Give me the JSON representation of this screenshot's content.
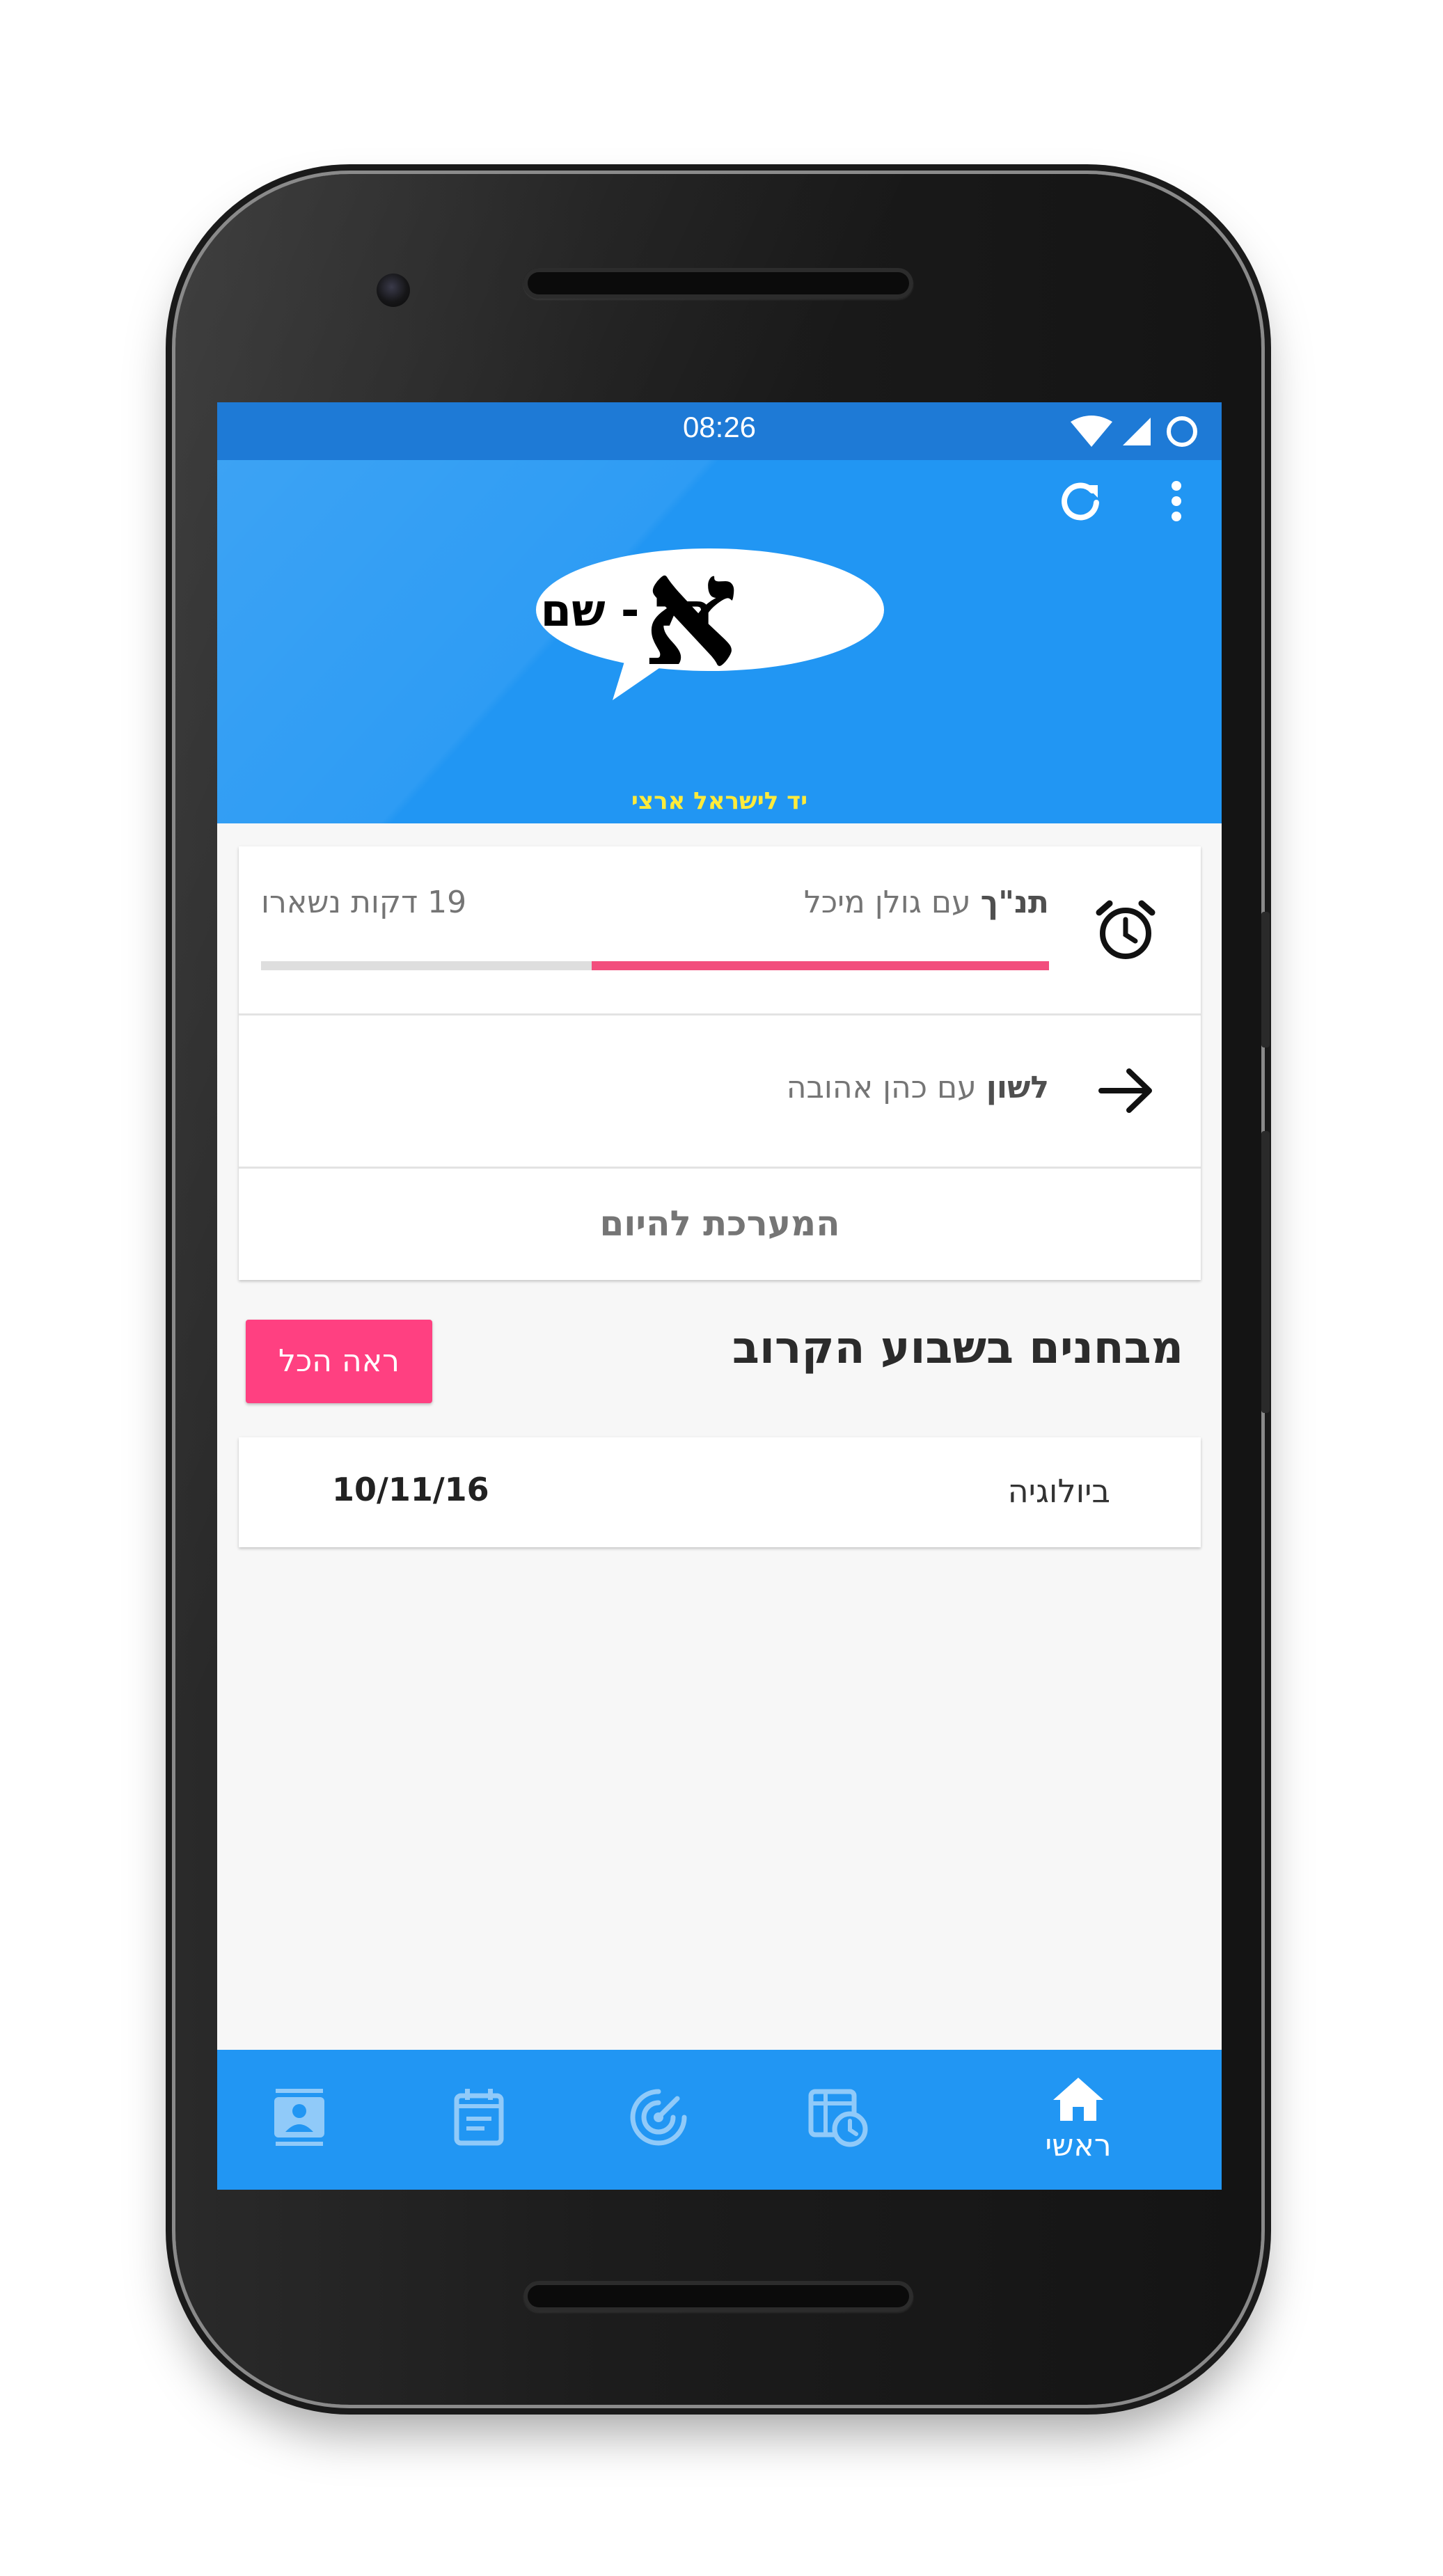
{
  "status_bar": {
    "time": "08:26",
    "icons": [
      "wifi-icon",
      "cell-signal-icon",
      "battery-circle-icon"
    ]
  },
  "app_bar": {
    "actions": [
      "refresh-icon",
      "more-vert-icon"
    ],
    "logo": {
      "main_text": "הל - שם",
      "letter": "א",
      "tagline": "יד לישראל ארצי"
    }
  },
  "schedule": {
    "current": {
      "subject": "תנ\"ך",
      "teacher": "עם גולן מיכל",
      "remaining": "19 דקות נשארו",
      "progress_fraction": 0.58,
      "icon": "alarm-clock-icon"
    },
    "next": {
      "subject": "לשון",
      "teacher": "עם כהן אהובה",
      "icon": "arrow-forward-icon"
    },
    "today_label": "המערכת להיום"
  },
  "exams": {
    "title": "מבחנים בשבוע הקרוב",
    "see_all": "ראה הכל",
    "items": [
      {
        "subject": "ביולוגיה",
        "date": "10/11/16"
      }
    ]
  },
  "bottom_nav": {
    "items": [
      {
        "icon": "contacts-icon",
        "label": ""
      },
      {
        "icon": "event-note-icon",
        "label": ""
      },
      {
        "icon": "radar-icon",
        "label": ""
      },
      {
        "icon": "timetable-icon",
        "label": ""
      },
      {
        "icon": "home-icon",
        "label": "ראשי",
        "active": true
      }
    ]
  },
  "colors": {
    "primary": "#2196f3",
    "primary_dark": "#1e7ad6",
    "accent": "#ff4081",
    "progress": "#f24e7d",
    "logo_tagline": "#ffeb3b",
    "nav_inactive": "#90caf9"
  }
}
